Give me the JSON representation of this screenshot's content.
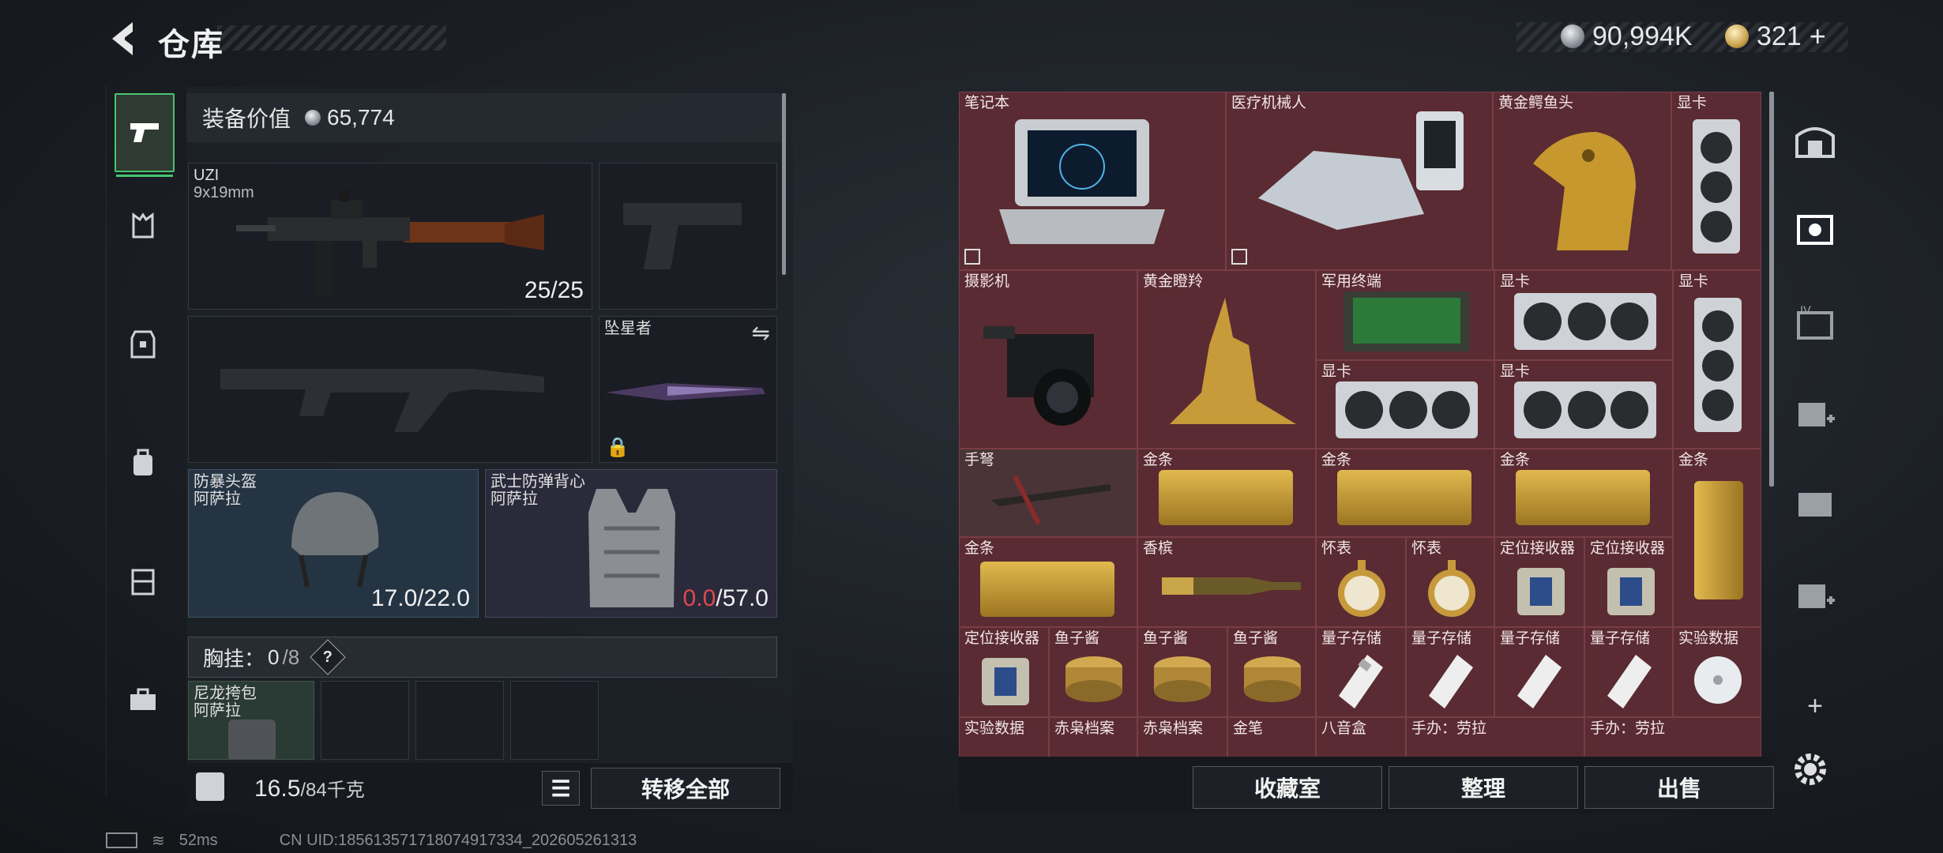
{
  "header": {
    "title": "仓库",
    "silver_amount": "90,994K",
    "gold_amount": "321"
  },
  "loadout": {
    "equip_value_label": "装备价值",
    "equip_value": "65,774",
    "primary": {
      "name": "UZI",
      "caliber": "9x19mm",
      "ammo": "25/25"
    },
    "melee": {
      "name": "坠星者"
    },
    "helmet": {
      "name": "防暴头盔",
      "brand": "阿萨拉",
      "durability": "17.0/22.0"
    },
    "vest": {
      "name": "武士防弹背心",
      "brand": "阿萨拉",
      "durability_current": "0.0",
      "durability_max": "/57.0"
    },
    "chest": {
      "label": "胸挂：",
      "count": "0",
      "total": "/8",
      "help": "?"
    },
    "pouch": {
      "name": "尼龙挎包",
      "brand": "阿萨拉"
    },
    "weight": {
      "current": "16.5",
      "max": "/84千克"
    },
    "transfer_all": "转移全部"
  },
  "storage": {
    "items": [
      "笔记本",
      "医疗机械人",
      "黄金鳄鱼头",
      "显卡",
      "摄影机",
      "黄金瞪羚",
      "军用终端",
      "显卡",
      "显卡",
      "显卡",
      "显卡",
      "手弩",
      "金条",
      "金条",
      "金条",
      "金条",
      "金条",
      "香槟",
      "怀表",
      "怀表",
      "定位接收器",
      "定位接收器",
      "定位接收器",
      "鱼子酱",
      "鱼子酱",
      "鱼子酱",
      "量子存储",
      "量子存储",
      "量子存储",
      "量子存储",
      "实验数据",
      "实验数据",
      "赤枭档案",
      "赤枭档案",
      "金笔",
      "八音盒",
      "手办：劳拉",
      "手办：劳拉"
    ],
    "buttons": {
      "collection": "收藏室",
      "sort": "整理",
      "sell": "出售"
    },
    "add": "+"
  },
  "status": {
    "ping": "52ms",
    "uid": "CN UID:185613571718074917334_202605261313"
  },
  "colors": {
    "accent": "#47c46f",
    "grid_bg": "#5a2b32",
    "danger": "#e0484f"
  }
}
